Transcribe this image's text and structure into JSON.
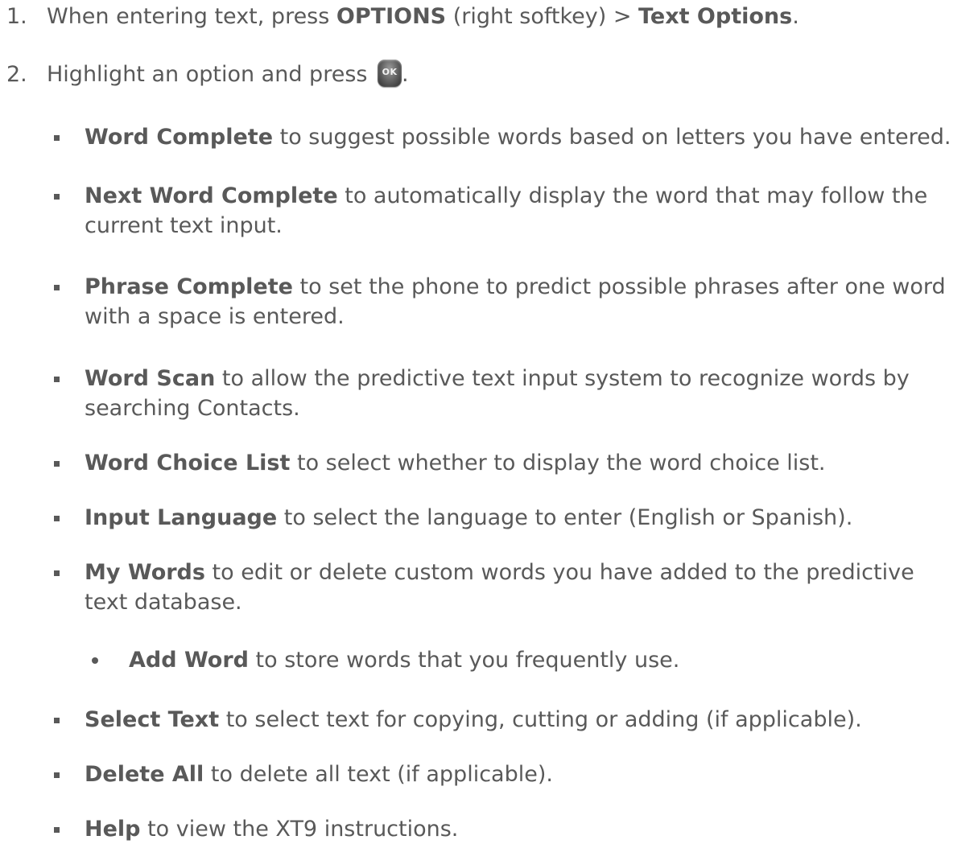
{
  "steps": [
    {
      "number": "1.",
      "pre": "When entering text, press ",
      "bold1": "OPTIONS",
      "mid": " (right softkey) > ",
      "bold2": "Text Options",
      "post": "."
    },
    {
      "number": "2.",
      "pre": "Highlight an option and press ",
      "key_label": "OK",
      "post": "."
    }
  ],
  "options": [
    {
      "term": "Word Complete",
      "desc": " to suggest possible words based on letters you have entered."
    },
    {
      "term": "Next Word Complete",
      "desc": " to automatically display the word that may follow the current text input."
    },
    {
      "term": "Phrase Complete",
      "desc": " to set the phone to predict possible phrases after one word with a space is entered."
    },
    {
      "term": "Word Scan",
      "desc": " to allow the predictive text input system to recognize words by searching Contacts."
    },
    {
      "term": "Word Choice List",
      "desc": " to select whether to display the word choice list."
    },
    {
      "term": "Input Language",
      "desc": " to select the language to enter (English or Spanish)."
    },
    {
      "term": "My Words",
      "desc": " to edit or delete custom words you have added to the predictive text database."
    },
    {
      "term": "Select Text",
      "desc": " to select text for copying, cutting or adding (if applicable)."
    },
    {
      "term": "Delete All",
      "desc": " to delete all text (if applicable)."
    },
    {
      "term": "Help",
      "desc": " to view the XT9 instructions."
    }
  ],
  "sub_options": [
    {
      "term": "Add Word",
      "desc": " to store words that you frequently use."
    }
  ]
}
